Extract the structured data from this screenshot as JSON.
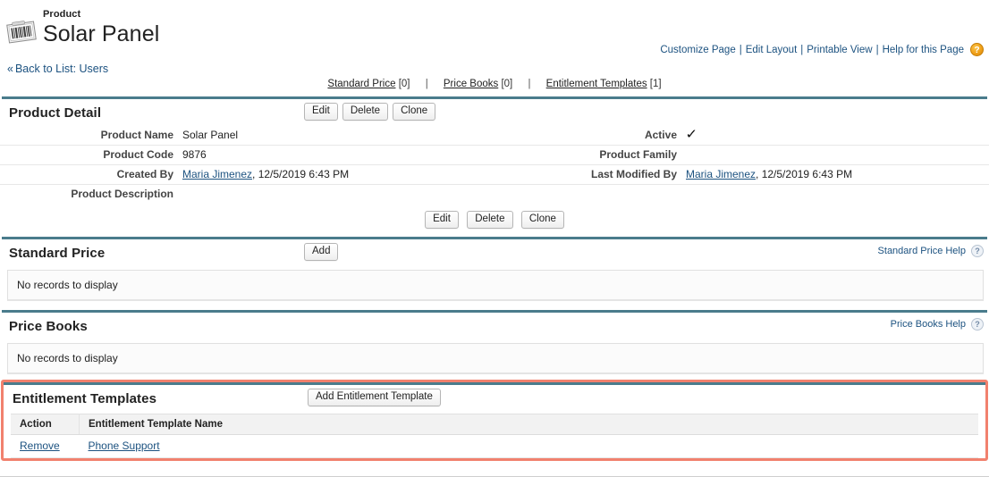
{
  "header": {
    "kicker": "Product",
    "title": "Solar Panel",
    "icon": "barcode-product-icon",
    "back_link": "Back to List: Users",
    "back_chevron": "«",
    "top_links": [
      {
        "label": "Customize Page"
      },
      {
        "label": "Edit Layout"
      },
      {
        "label": "Printable View"
      },
      {
        "label": "Help for this Page"
      }
    ],
    "top_separator": "|",
    "help_icon_glyph": "?"
  },
  "section_nav": [
    {
      "label": "Standard Price",
      "count": "[0]"
    },
    {
      "label": "Price Books",
      "count": "[0]"
    },
    {
      "label": "Entitlement Templates",
      "count": "[1]"
    }
  ],
  "section_nav_separator": "|",
  "product_detail": {
    "title": "Product Detail",
    "buttons": [
      {
        "label": "Edit"
      },
      {
        "label": "Delete"
      },
      {
        "label": "Clone"
      }
    ],
    "rows": [
      {
        "left_label": "Product Name",
        "left_value": "Solar Panel",
        "right_label": "Active",
        "right_value": "✓",
        "right_is_check": true
      },
      {
        "left_label": "Product Code",
        "left_value": "9876",
        "right_label": "Product Family",
        "right_value": ""
      },
      {
        "left_label": "Created By",
        "left_link": "Maria Jimenez",
        "left_value": ", 12/5/2019 6:43 PM",
        "right_label": "Last Modified By",
        "right_link": "Maria Jimenez",
        "right_value": ", 12/5/2019 6:43 PM"
      },
      {
        "left_label": "Product Description",
        "left_value": "",
        "right_label": "",
        "right_value": ""
      }
    ]
  },
  "standard_price": {
    "title": "Standard Price",
    "add_button": "Add",
    "help_link": "Standard Price Help",
    "help_glyph": "?",
    "empty_text": "No records to display"
  },
  "price_books": {
    "title": "Price Books",
    "help_link": "Price Books Help",
    "help_glyph": "?",
    "empty_text": "No records to display"
  },
  "entitlement_templates": {
    "title": "Entitlement Templates",
    "add_button": "Add Entitlement Template",
    "columns": [
      "Action",
      "Entitlement Template Name"
    ],
    "rows": [
      {
        "action": "Remove",
        "name": "Phone Support"
      }
    ]
  },
  "colors": {
    "panel_rule": "#4a7c8c",
    "link": "#1c5280",
    "highlight_border": "#f1816e",
    "help_orb": "#f0a11a"
  }
}
